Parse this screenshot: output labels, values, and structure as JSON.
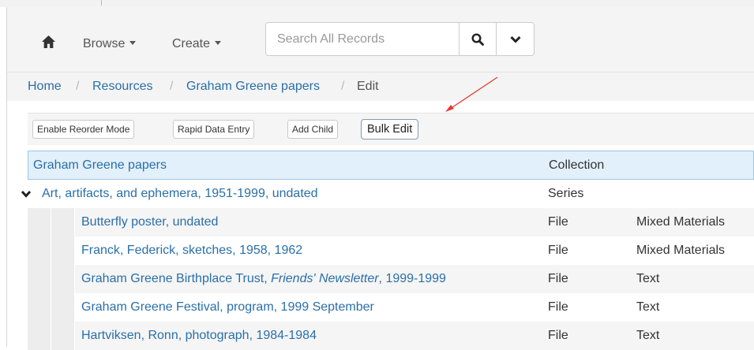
{
  "navbar": {
    "browse_label": "Browse",
    "create_label": "Create",
    "search_placeholder": "Search All Records"
  },
  "breadcrumb": {
    "items": [
      "Home",
      "Resources",
      "Graham Greene papers",
      "Edit"
    ],
    "separator": "/"
  },
  "toolbar": {
    "reorder_label": "Enable Reorder Mode",
    "rapid_label": "Rapid Data Entry",
    "add_child_label": "Add Child",
    "bulk_edit_label": "Bulk Edit"
  },
  "tree": {
    "root": {
      "title": "Graham Greene papers",
      "level": "Collection"
    },
    "series": {
      "title": "Art, artifacts, and ephemera, 1951-1999, undated",
      "level": "Series"
    },
    "children": [
      {
        "title": "Butterfly poster, undated",
        "level": "File",
        "type": "Mixed Materials"
      },
      {
        "title": "Franck, Federick, sketches, 1958, 1962",
        "level": "File",
        "type": "Mixed Materials"
      },
      {
        "title_prefix": "Graham Greene Birthplace Trust, ",
        "title_italic": "Friends' Newsletter",
        "title_suffix": ", 1999-1999",
        "level": "File",
        "type": "Text"
      },
      {
        "title": "Graham Greene Festival, program, 1999 September",
        "level": "File",
        "type": "Text"
      },
      {
        "title": "Hartviksen, Ronn, photograph, 1984-1984",
        "level": "File",
        "type": "Text"
      }
    ]
  },
  "colors": {
    "link": "#2a6fa8",
    "annotation_arrow": "#e53935",
    "selected_row_bg": "#e2f0fb"
  }
}
